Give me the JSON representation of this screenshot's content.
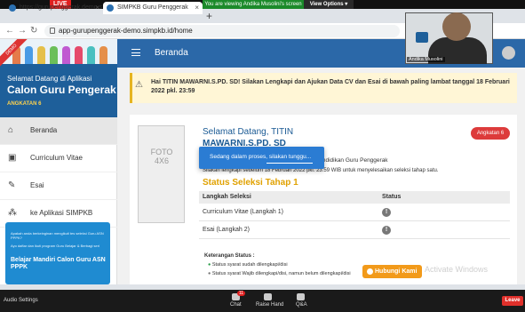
{
  "zoom": {
    "live_label": "LIVE",
    "viewing_banner": "You are viewing Andika Musolini's screen",
    "view_options": "View Options ▾",
    "webcam_name": "Andika Musolini",
    "bottom": {
      "audio": "Audio Settings",
      "chat": "Chat",
      "chat_count": "11",
      "raise_hand": "Raise Hand",
      "qa": "Q&A",
      "leave": "Leave"
    }
  },
  "browser": {
    "tabs": [
      {
        "label": "https://gurupenggerak.demo.s"
      },
      {
        "label": "SIMPKB Guru Penggerak"
      }
    ],
    "url": "app-gurupenggerak-demo.simpkb.id/home"
  },
  "sidebar": {
    "ribbon": "DEMO",
    "welcome": "Selamat Datang di Aplikasi",
    "app_title": "Calon Guru Pengerak",
    "angkatan": "ANGKATAN 6",
    "menu": [
      {
        "icon": "home-icon",
        "label": "Beranda"
      },
      {
        "icon": "cv-icon",
        "label": "Curriculum Vitae"
      },
      {
        "icon": "edit-icon",
        "label": "Esai"
      },
      {
        "icon": "apps-icon",
        "label": "ke Aplikasi SIMPKB"
      }
    ],
    "banner": {
      "text1": "Apakah anda berkeinginan mengikuti tes seleksi Guru ASN PPPK?",
      "text2": "Ayo daftar dan ikuti program Guru Belajar & Berbagi seri",
      "title": "Belajar Mandiri Calon Guru ASN PPPK"
    }
  },
  "header": {
    "title": "Beranda"
  },
  "alert": {
    "text": "Hai TITIN MAWARNI.S.PD. SD! Silakan Lengkapi dan Ajukan Data CV dan Esai di bawah paling lambat tanggal 18 Februari 2022 pkl. 23:59"
  },
  "card": {
    "photo_label": "FOTO 4X6",
    "welcome_prefix": "Selamat Datang, TITIN",
    "welcome_name": "MAWARNI.S.PD. SD",
    "angkatan_badge": "Angkatan 6",
    "info1": "endaftaran Pendidikan Guru Penggerak",
    "info2": "Silakan lengkapi sebelum 18 Februari 2022 pkl. 23:59 WIB untuk menyelesaikan seleksi tahap satu.",
    "section_title": "Status Seleksi Tahap 1",
    "table": {
      "headers": [
        "Langkah Seleksi",
        "Status"
      ],
      "rows": [
        {
          "step": "Curriculum Vitae (Langkah 1)",
          "status": "!"
        },
        {
          "step": "Esai (Langkah 2)",
          "status": "!"
        }
      ]
    },
    "keterangan_title": "Keterangan Status :",
    "keterangan": [
      "Status syarat sudah dilengkapi/disi",
      "Status syarat Wajib dilengkapi/disi, namun belum dilengkapi/disi"
    ]
  },
  "loading": {
    "text": "Sedang dalam proses, silakan tunggu..."
  },
  "contact_button": "Hubungi Kami",
  "watermark": "Activate Windows"
}
